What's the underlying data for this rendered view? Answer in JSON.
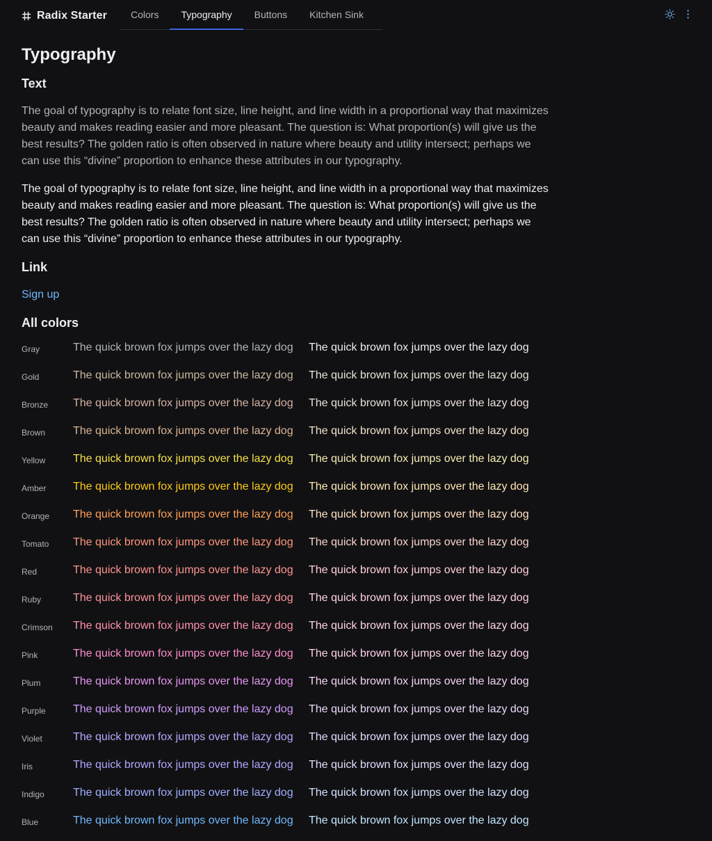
{
  "header": {
    "brand_title": "Radix Starter",
    "brand_icon": "hash-icon",
    "tabs": [
      {
        "label": "Colors",
        "active": false
      },
      {
        "label": "Typography",
        "active": true
      },
      {
        "label": "Buttons",
        "active": false
      },
      {
        "label": "Kitchen Sink",
        "active": false
      }
    ],
    "accent": "#3e63dd",
    "icons": [
      "sun-icon",
      "more-vertical-icon"
    ]
  },
  "main": {
    "page_title": "Typography",
    "text_section": {
      "heading": "Text",
      "para_muted": "The goal of typography is to relate font size, line height, and line width in a proportional way that maximizes beauty and makes reading easier and more pleasant. The question is: What proportion(s) will give us the best results? The golden ratio is often observed in nature where beauty and utility intersect; perhaps we can use this “divine” proportion to enhance these attributes in our typography.",
      "para_strong": "The goal of typography is to relate font size, line height, and line width in a proportional way that maximizes beauty and makes reading easier and more pleasant. The question is: What proportion(s) will give us the best results? The golden ratio is often observed in nature where beauty and utility intersect; perhaps we can use this “divine” proportion to enhance these attributes in our typography."
    },
    "link_section": {
      "heading": "Link",
      "link_label": "Sign up"
    },
    "colors_section": {
      "heading": "All colors",
      "sample_text": "The quick brown fox jumps over the lazy dog",
      "rows": [
        {
          "name": "Gray",
          "color_a": "#b0b4ba",
          "color_b": "#edeef0"
        },
        {
          "name": "Gold",
          "color_a": "#cbb99f",
          "color_b": "#e8e2d9"
        },
        {
          "name": "Bronze",
          "color_a": "#d4b3a5",
          "color_b": "#ede0d9"
        },
        {
          "name": "Brown",
          "color_a": "#dbb594",
          "color_b": "#f2e1ca"
        },
        {
          "name": "Yellow",
          "color_a": "#f5e147",
          "color_b": "#f6eeb4"
        },
        {
          "name": "Amber",
          "color_a": "#ffca16",
          "color_b": "#ffe7b3"
        },
        {
          "name": "Orange",
          "color_a": "#ffa057",
          "color_b": "#ffe0c2"
        },
        {
          "name": "Tomato",
          "color_a": "#ff977d",
          "color_b": "#fbd3cb"
        },
        {
          "name": "Red",
          "color_a": "#ff9592",
          "color_b": "#ffd1d9"
        },
        {
          "name": "Ruby",
          "color_a": "#ff949d",
          "color_b": "#fed2e1"
        },
        {
          "name": "Crimson",
          "color_a": "#ff92ad",
          "color_b": "#fdd3e8"
        },
        {
          "name": "Pink",
          "color_a": "#ff8dcc",
          "color_b": "#fdd1ea"
        },
        {
          "name": "Plum",
          "color_a": "#e796f3",
          "color_b": "#f4d4f4"
        },
        {
          "name": "Purple",
          "color_a": "#d19dff",
          "color_b": "#ecd9fa"
        },
        {
          "name": "Violet",
          "color_a": "#baa7ff",
          "color_b": "#e2ddfe"
        },
        {
          "name": "Iris",
          "color_a": "#b1a9ff",
          "color_b": "#e0dffe"
        },
        {
          "name": "Indigo",
          "color_a": "#9eb1ff",
          "color_b": "#d6e1ff"
        },
        {
          "name": "Blue",
          "color_a": "#70b8ff",
          "color_b": "#c2e6ff"
        }
      ]
    }
  }
}
